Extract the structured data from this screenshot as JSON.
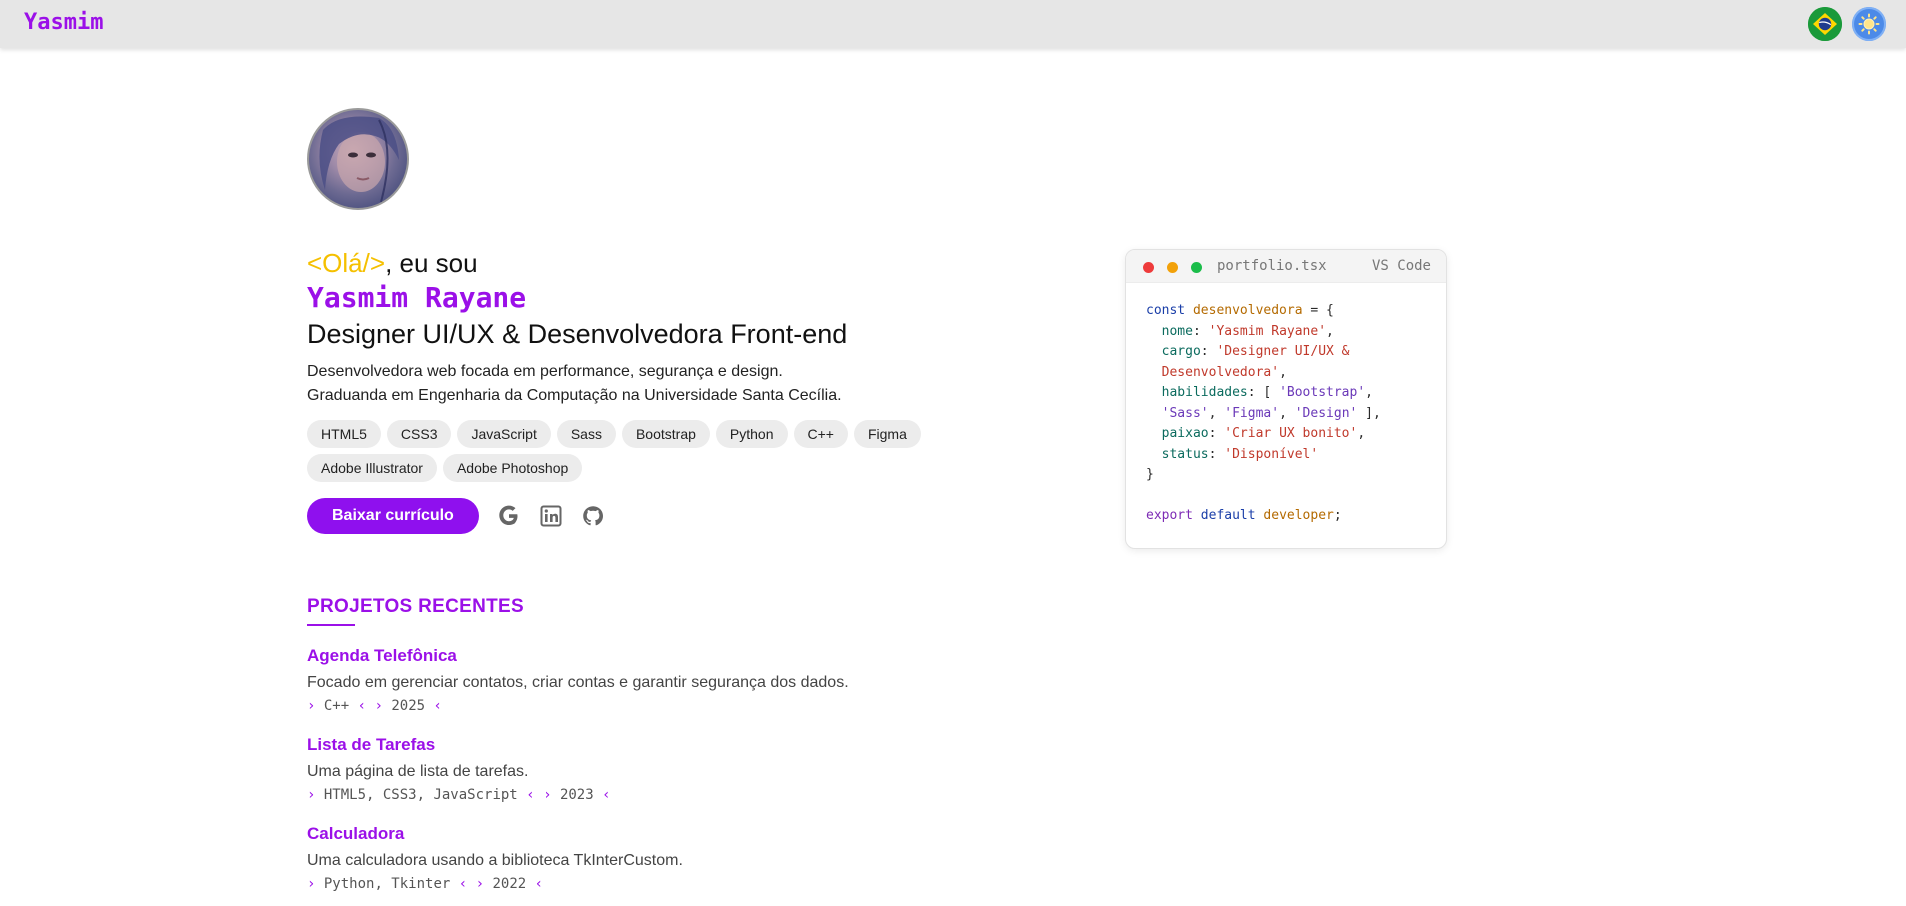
{
  "header": {
    "brand": "Yasmim",
    "language_button_icon": "brazil-flag-icon",
    "theme_button_icon": "sun-icon"
  },
  "hero": {
    "greeting_tag": "<Olá/>",
    "greeting_rest": ", eu sou",
    "name": "Yasmim Rayane",
    "role": "Designer UI/UX & Desenvolvedora Front-end",
    "description_line1": "Desenvolvedora web focada em performance, segurança e design.",
    "description_line2": "Graduanda em Engenharia da Computação na Universidade Santa Cecília.",
    "skills": [
      "HTML5",
      "CSS3",
      "JavaScript",
      "Sass",
      "Bootstrap",
      "Python",
      "C++",
      "Figma",
      "Adobe Illustrator",
      "Adobe Photoshop"
    ],
    "cv_button": "Baixar currículo",
    "social_icons": [
      "google-icon",
      "linkedin-icon",
      "github-icon"
    ]
  },
  "code_card": {
    "file_name": "portfolio.tsx",
    "editor": "VS Code",
    "code": {
      "l1_kw": "const",
      "l1_var": "desenvolvedora",
      "l1_rest": " = {",
      "l2_prop": "nome",
      "l2_val": "'Yasmim Rayane'",
      "l3_prop": "cargo",
      "l3_val_a": "'Designer UI/UX &",
      "l4_val_b": "Desenvolvedora'",
      "l5_prop": "habilidades",
      "l5_v1": "'Bootstrap'",
      "l6_v2": "'Sass'",
      "l6_v3": "'Figma'",
      "l6_v4": "'Design'",
      "l7_prop": "paixao",
      "l7_val": "'Criar UX bonito'",
      "l8_prop": "status",
      "l8_val": "'Disponível'",
      "l9": "}",
      "l11_kw1": "export",
      "l11_kw2": "default",
      "l11_var": "developer",
      "l11_end": ";"
    }
  },
  "projects": {
    "section_title": "PROJETOS RECENTES",
    "items": [
      {
        "title": "Agenda Telefônica",
        "description": "Focado em gerenciar contatos, criar contas e garantir segurança dos dados.",
        "tech": "C++",
        "year": "2025"
      },
      {
        "title": "Lista de Tarefas",
        "description": "Uma página de lista de tarefas.",
        "tech": "HTML5, CSS3, JavaScript",
        "year": "2023"
      },
      {
        "title": "Calculadora",
        "description": "Uma calculadora usando a biblioteca TkInterCustom.",
        "tech": "Python, Tkinter",
        "year": "2022"
      }
    ]
  },
  "colors": {
    "accent": "#9b10e8",
    "greeting_tag": "#f5c000",
    "topbar_bg": "#e6e6e6"
  }
}
